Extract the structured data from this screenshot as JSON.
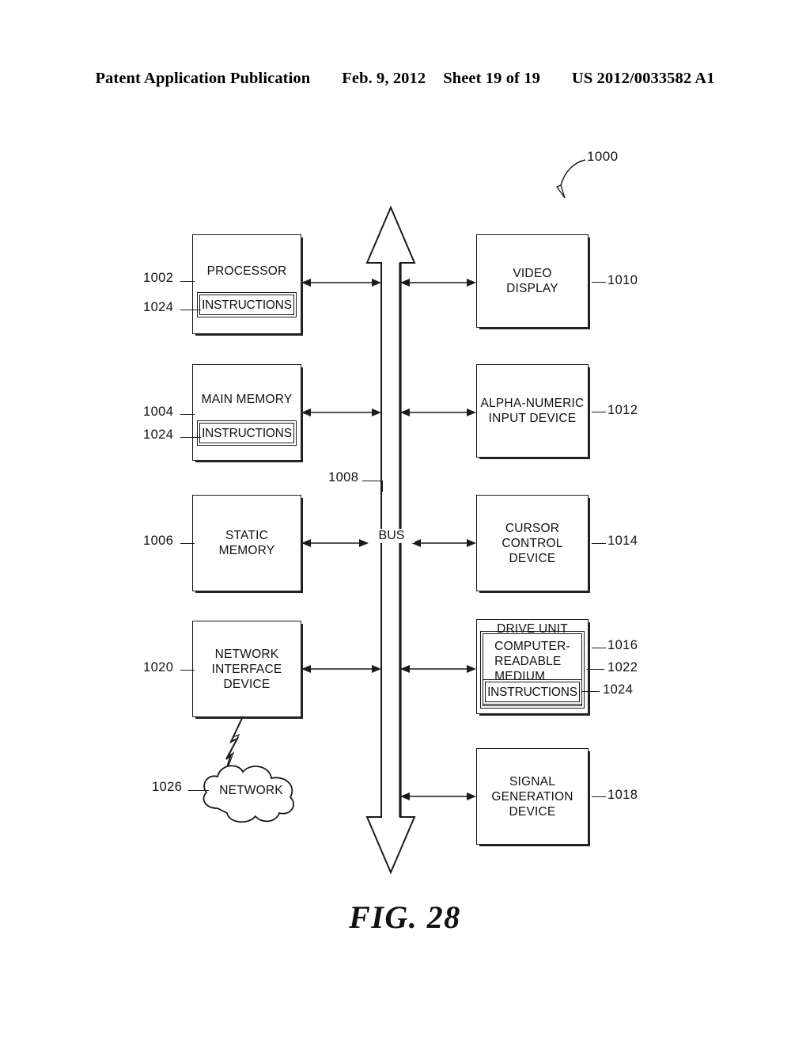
{
  "header": {
    "publication": "Patent Application Publication",
    "date": "Feb. 9, 2012",
    "sheet": "Sheet 19 of 19",
    "patent_number": "US 2012/0033582 A1"
  },
  "figure": {
    "caption": "FIG. 28",
    "system_ref": "1000",
    "bus_label": "BUS",
    "bus_ref": "1008"
  },
  "left_column": [
    {
      "label": "PROCESSOR",
      "ref": "1002",
      "inner_label": "INSTRUCTIONS",
      "inner_ref": "1024"
    },
    {
      "label": "MAIN MEMORY",
      "ref": "1004",
      "inner_label": "INSTRUCTIONS",
      "inner_ref": "1024"
    },
    {
      "label": "STATIC\nMEMORY",
      "ref": "1006"
    },
    {
      "label": "NETWORK\nINTERFACE\nDEVICE",
      "ref": "1020"
    }
  ],
  "right_column": [
    {
      "label": "VIDEO\nDISPLAY",
      "ref": "1010"
    },
    {
      "label": "ALPHA-NUMERIC\nINPUT DEVICE",
      "ref": "1012"
    },
    {
      "label": "CURSOR\nCONTROL\nDEVICE",
      "ref": "1014"
    },
    {
      "label": "SIGNAL\nGENERATION\nDEVICE",
      "ref": "1018"
    }
  ],
  "drive_unit": {
    "label": "DRIVE UNIT",
    "ref": "1016",
    "medium_label": "COMPUTER-\nREADABLE\nMEDIUM",
    "medium_ref": "1022",
    "instructions_label": "INSTRUCTIONS",
    "instructions_ref": "1024"
  },
  "network": {
    "label": "NETWORK",
    "ref": "1026"
  },
  "colors": {
    "ink": "#111111",
    "background": "#ffffff"
  }
}
